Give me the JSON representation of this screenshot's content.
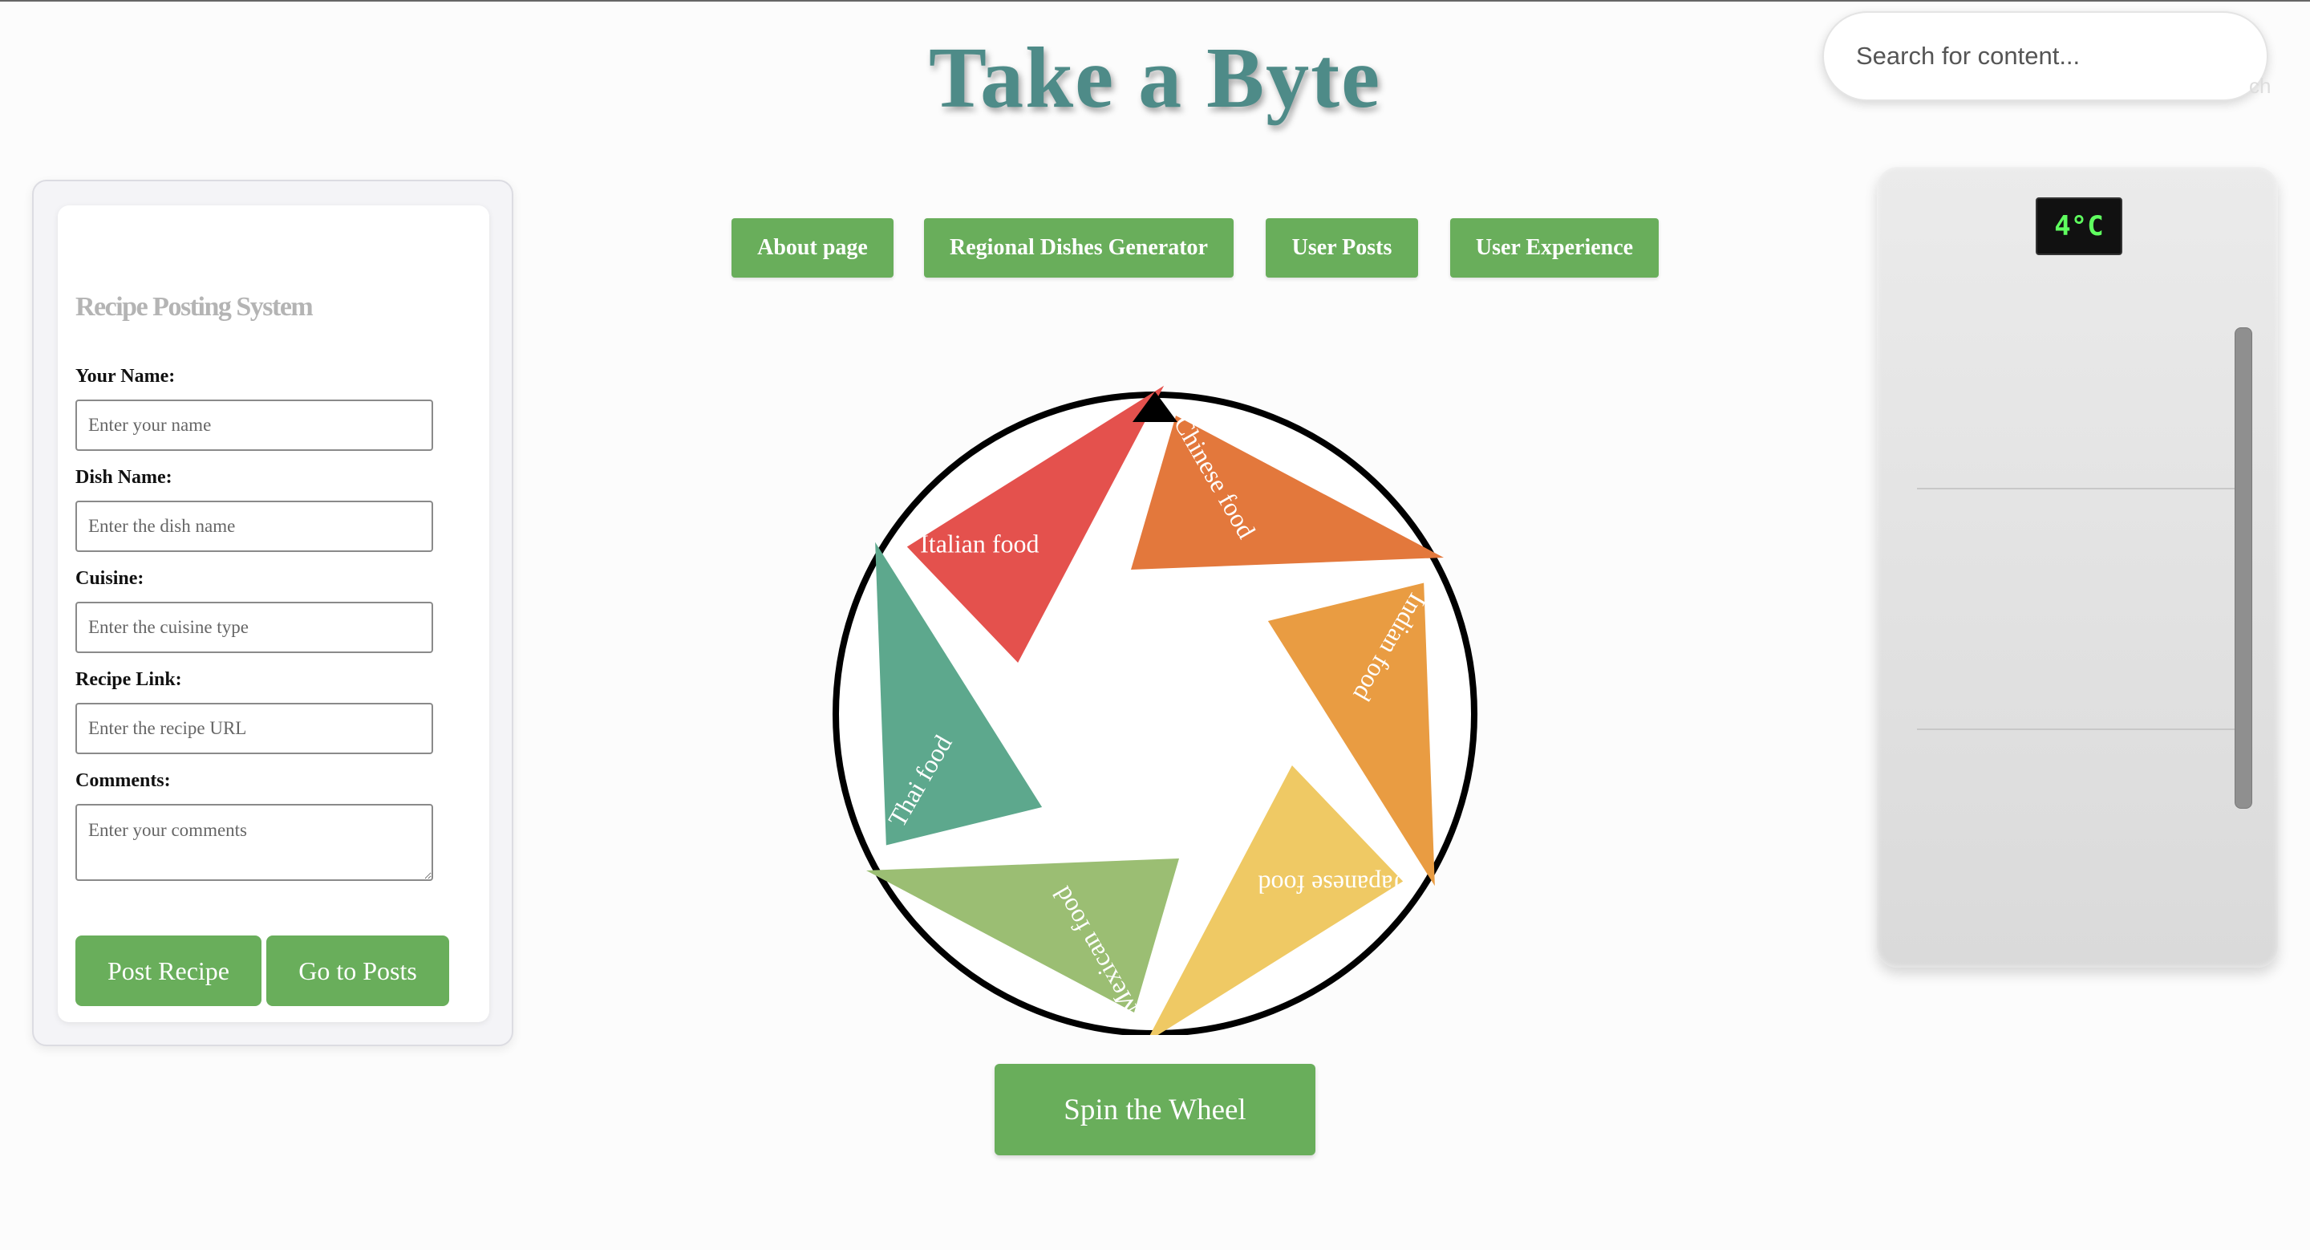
{
  "header": {
    "title": "Take a Byte",
    "search_placeholder": "Search for content...",
    "search_tail": "ch"
  },
  "nav": {
    "items": [
      "About page",
      "Regional Dishes Generator",
      "User Posts",
      "User Experience"
    ]
  },
  "recipe_form": {
    "title": "Recipe Posting System",
    "fields": [
      {
        "label": "Your Name:",
        "placeholder": "Enter your name"
      },
      {
        "label": "Dish Name:",
        "placeholder": "Enter the dish name"
      },
      {
        "label": "Cuisine:",
        "placeholder": "Enter the cuisine type"
      },
      {
        "label": "Recipe Link:",
        "placeholder": "Enter the recipe URL"
      },
      {
        "label": "Comments:",
        "placeholder": "Enter your comments"
      }
    ],
    "post_button": "Post Recipe",
    "posts_button": "Go to Posts"
  },
  "wheel": {
    "segments": [
      {
        "label": "Chinese food",
        "color": "#e3783c"
      },
      {
        "label": "Indian food",
        "color": "#e99c42"
      },
      {
        "label": "Japanese food",
        "color": "#efc964"
      },
      {
        "label": "Mexican food",
        "color": "#9bbe73"
      },
      {
        "label": "Thai food",
        "color": "#5da88d"
      },
      {
        "label": "Italian food",
        "color": "#e4514d"
      }
    ],
    "spin_button": "Spin the Wheel"
  },
  "fridge": {
    "temperature": "4°C"
  }
}
